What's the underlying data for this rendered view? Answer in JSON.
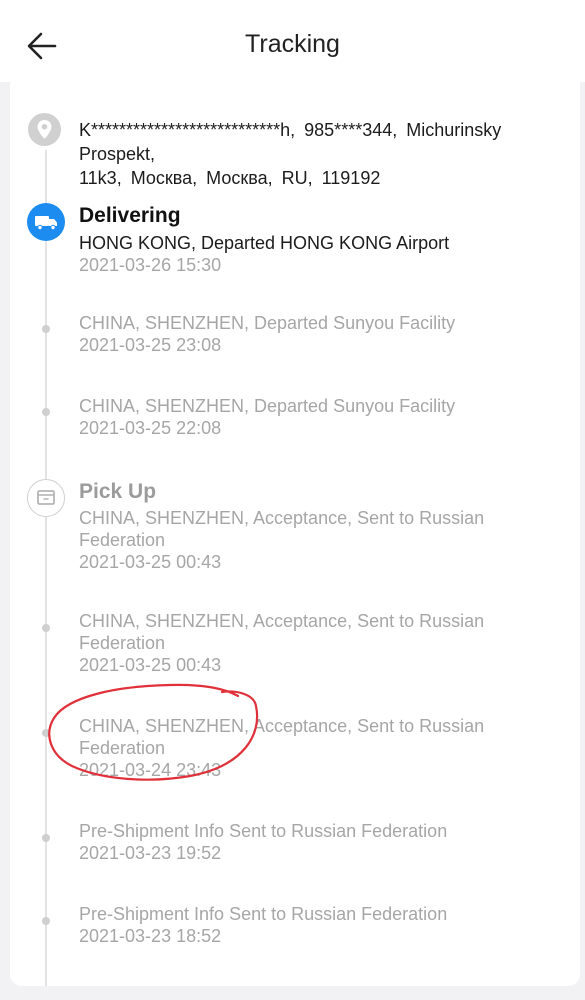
{
  "header": {
    "title": "Tracking",
    "back_icon": "arrow-left-icon"
  },
  "address": {
    "line1": "K***************************h, 985****344, Michurinsky Prospekt,",
    "line2": "11k3, Москва, Москва, RU, 119192",
    "icon": "location-pin-icon"
  },
  "events": [
    {
      "status": "Delivering",
      "description": "HONG KONG, Departed HONG KONG Airport",
      "time": "2021-03-26 15:30",
      "icon": "truck-icon"
    },
    {
      "status": "",
      "description": "CHINA, SHENZHEN, Departed Sunyou Facility",
      "time": "2021-03-25 23:08"
    },
    {
      "status": "",
      "description": "CHINA, SHENZHEN, Departed Sunyou Facility",
      "time": "2021-03-25 22:08"
    },
    {
      "status": "Pick Up",
      "description": "CHINA, SHENZHEN, Acceptance, Sent to Russian Federation",
      "time": "2021-03-25 00:43",
      "icon": "package-icon"
    },
    {
      "status": "",
      "description": "CHINA, SHENZHEN, Acceptance, Sent to Russian Federation",
      "time": "2021-03-25 00:43"
    },
    {
      "status": "",
      "description": "CHINA, SHENZHEN, Acceptance, Sent to Russian Federation",
      "time": "2021-03-24 23:43"
    },
    {
      "status": "",
      "description": "Pre-Shipment Info Sent to Russian Federation",
      "time": "2021-03-23 19:52"
    },
    {
      "status": "",
      "description": "Pre-Shipment Info Sent to Russian Federation",
      "time": "2021-03-23 18:52"
    }
  ],
  "colors": {
    "accent": "#1d8cf0",
    "annotation": "#e0313b",
    "muted_text": "#a6a6a6"
  }
}
